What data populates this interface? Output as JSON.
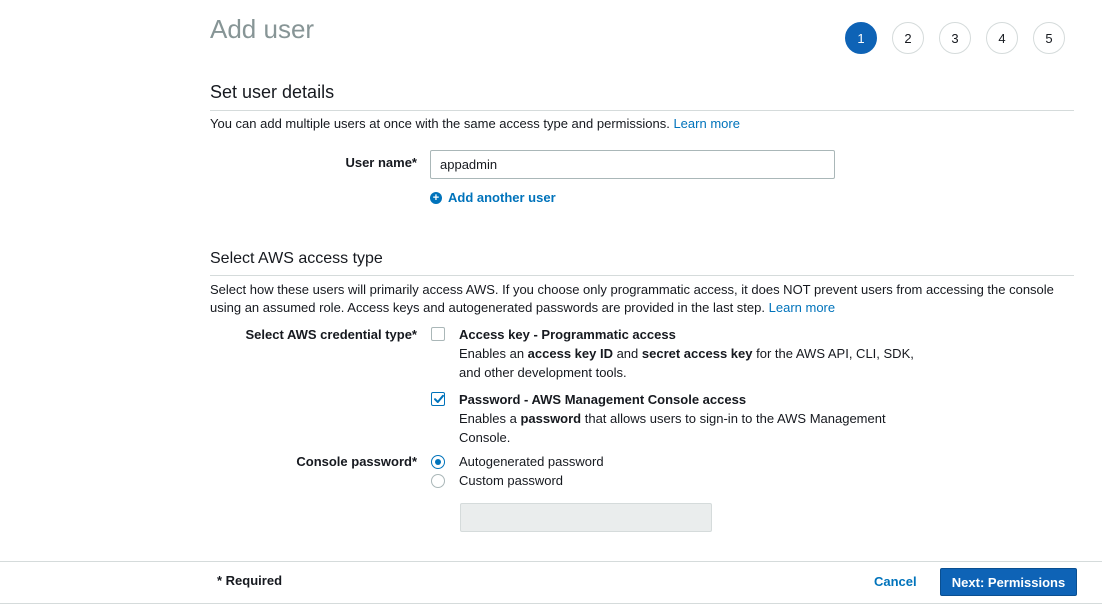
{
  "page": {
    "title": "Add user"
  },
  "steps": [
    "1",
    "2",
    "3",
    "4",
    "5"
  ],
  "active_step": "1",
  "user_details": {
    "heading": "Set user details",
    "description": "You can add multiple users at once with the same access type and permissions.",
    "learn_more": "Learn more",
    "user_name_label": "User name*",
    "user_name_value": "appadmin",
    "add_another_user": "Add another user"
  },
  "access_type": {
    "heading": "Select AWS access type",
    "description": "Select how these users will primarily access AWS. If you choose only programmatic access, it does NOT prevent users from accessing the console using an assumed role. Access keys and autogenerated passwords are provided in the last step.",
    "learn_more": "Learn more",
    "credential_label": "Select AWS credential type*",
    "programmatic": {
      "title": "Access key - Programmatic access",
      "desc_1": "Enables an ",
      "desc_b1": "access key ID",
      "desc_2": " and ",
      "desc_b2": "secret access key",
      "desc_3": " for the AWS API, CLI, SDK, and other development tools.",
      "checked": false
    },
    "console": {
      "title": "Password - AWS Management Console access",
      "desc_1": "Enables a ",
      "desc_b1": "password",
      "desc_2": " that allows users to sign-in to the AWS Management Console.",
      "checked": true
    },
    "console_password_label": "Console password*",
    "password_options": {
      "autogenerated": "Autogenerated password",
      "custom": "Custom password",
      "selected": "autogenerated"
    }
  },
  "footer": {
    "required_note": "* Required",
    "cancel": "Cancel",
    "next": "Next: Permissions"
  },
  "colors": {
    "accent": "#0073bb",
    "primary_button": "#0e63b6",
    "title_gray": "#879596"
  },
  "icons": {
    "add_user": "plus-circle-icon",
    "checkbox_checked": "checkmark-icon"
  }
}
